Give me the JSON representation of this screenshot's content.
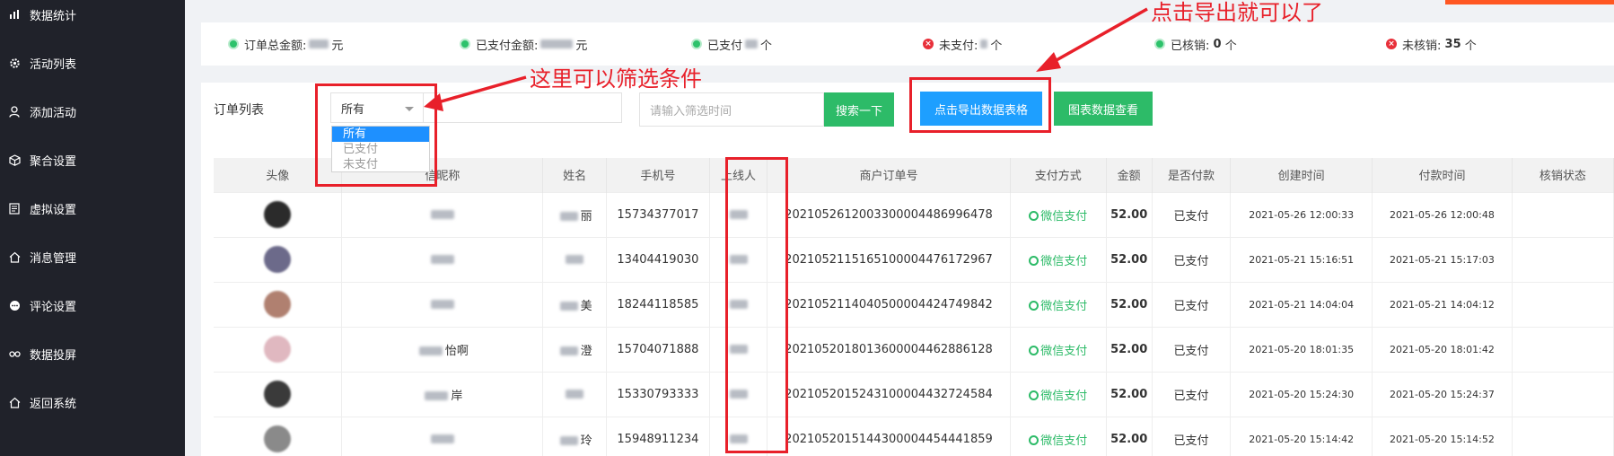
{
  "sidebar": {
    "items": [
      {
        "label": "数据统计",
        "icon": "chart-icon"
      },
      {
        "label": "活动列表",
        "icon": "gear-icon"
      },
      {
        "label": "添加活动",
        "icon": "user-icon"
      },
      {
        "label": "聚合设置",
        "icon": "cube-icon"
      },
      {
        "label": "虚拟设置",
        "icon": "doc-icon"
      },
      {
        "label": "消息管理",
        "icon": "home-icon"
      },
      {
        "label": "评论设置",
        "icon": "chat-icon"
      },
      {
        "label": "数据投屏",
        "icon": "link-icon"
      },
      {
        "label": "返回系统",
        "icon": "home-icon"
      }
    ]
  },
  "stats": {
    "total_amount_label": "订单总金额:",
    "total_amount_unit": "元",
    "paid_amount_label": "已支付金额:",
    "paid_amount_unit": "元",
    "paid_label": "已支付",
    "paid_unit": "个",
    "unpaid_label": "未支付:",
    "unpaid_unit": "个",
    "verified_label": "已核销:",
    "verified_value": "0",
    "verified_unit": "个",
    "unverified_label": "未核销:",
    "unverified_value": "35",
    "unverified_unit": "个"
  },
  "toolbar": {
    "list_label": "订单列表",
    "filter_selected": "所有",
    "filter_options": [
      "所有",
      "已支付",
      "未支付"
    ],
    "date_placeholder": "请输入筛选时间",
    "search_label": "搜索一下",
    "export_label": "点击导出数据表格",
    "chart_label": "图表数据查看"
  },
  "table": {
    "columns": [
      "头像",
      "微信昵称",
      "姓名",
      "手机号",
      "上线人",
      "商户订单号",
      "支付方式",
      "金额",
      "是否付款",
      "创建时间",
      "付款时间",
      "核销状态"
    ],
    "header_nickname_visible": "信昵称",
    "rows": [
      {
        "name_suffix": "丽",
        "phone": "15734377017",
        "order": "20210526120033000044869964​78",
        "pay": "微信支付",
        "amount": "52.00",
        "paid": "已支付",
        "created": "2021-05-26 12:00:33",
        "paid_time": "2021-05-26 12:00:48",
        "nick": "",
        "avatar_color": "#2b2b2b"
      },
      {
        "name_suffix": "",
        "phone": "13404419030",
        "order": "20210521151651000044761729​67",
        "pay": "微信支付",
        "amount": "52.00",
        "paid": "已支付",
        "created": "2021-05-21 15:16:51",
        "paid_time": "2021-05-21 15:17:03",
        "nick": "",
        "avatar_color": "#6c6a8a"
      },
      {
        "name_suffix": "美",
        "phone": "18244118585",
        "order": "20210521140405000044247498​42",
        "pay": "微信支付",
        "amount": "52.00",
        "paid": "已支付",
        "created": "2021-05-21 14:04:04",
        "paid_time": "2021-05-21 14:04:12",
        "nick": "",
        "avatar_color": "#b08070"
      },
      {
        "name_suffix": "澄",
        "phone": "15704071888",
        "order": "20210520180136000044628861​28",
        "pay": "微信支付",
        "amount": "52.00",
        "paid": "已支付",
        "created": "2021-05-20 18:01:35",
        "paid_time": "2021-05-20 18:01:42",
        "nick": "怡啊",
        "avatar_color": "#e0b8c0"
      },
      {
        "name_suffix": "",
        "phone": "15330793333",
        "order": "20210520152431000044327245​84",
        "pay": "微信支付",
        "amount": "52.00",
        "paid": "已支付",
        "created": "2021-05-20 15:24:30",
        "paid_time": "2021-05-20 15:24:37",
        "nick": "岸",
        "avatar_color": "#3a3a3a"
      },
      {
        "name_suffix": "玲",
        "phone": "15948911234",
        "order": "20210520151443000044544418​59",
        "pay": "微信支付",
        "amount": "52.00",
        "paid": "已支付",
        "created": "2021-05-20 15:14:42",
        "paid_time": "2021-05-20 15:14:52",
        "nick": "",
        "avatar_color": "#8a8a8a"
      }
    ]
  },
  "annotations": {
    "export_hint": "点击导出就可以了",
    "filter_hint": "这里可以筛选条件"
  },
  "colors": {
    "sidebar_bg": "#20222a",
    "green": "#2dbb68",
    "blue": "#1e9fff",
    "red": "#e8202a"
  }
}
